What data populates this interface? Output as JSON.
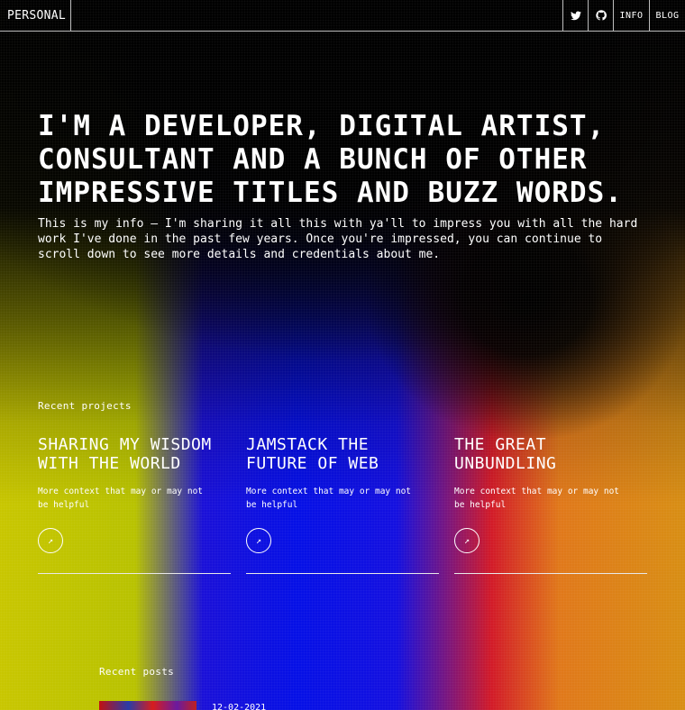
{
  "header": {
    "brand": "PERSONAL",
    "nav": [
      {
        "label": "INFO"
      },
      {
        "label": "BLOG"
      }
    ],
    "icons": [
      "twitter-icon",
      "github-icon"
    ]
  },
  "hero": {
    "title": "I'M A DEVELOPER, DIGITAL ARTIST, CONSULTANT AND A BUNCH OF OTHER IMPRESSIVE TITLES AND BUZZ WORDS.",
    "text": "This is my info — I'm sharing it all this with ya'll to impress you with all the hard work I've done in the past few years. Once you're impressed, you can continue to scroll down to see more details and credentials about me."
  },
  "projects": {
    "label": "Recent projects",
    "items": [
      {
        "title": "SHARING MY WISDOM WITH THE WORLD",
        "desc": "More context that may or may not be helpful"
      },
      {
        "title": "JAMSTACK THE FUTURE OF WEB",
        "desc": "More context that may or may not be helpful"
      },
      {
        "title": "THE GREAT UNBUNDLING",
        "desc": "More context that may or may not be helpful"
      }
    ],
    "link_glyph": "↗"
  },
  "posts": {
    "label": "Recent posts",
    "items": [
      {
        "date": "12-02-2021"
      }
    ]
  }
}
